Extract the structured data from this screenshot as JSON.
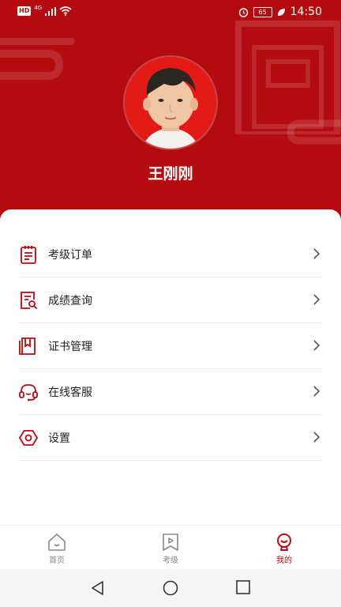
{
  "status_bar": {
    "left_badge": "HD",
    "network": "4G",
    "battery": "65",
    "time": "14:50"
  },
  "profile": {
    "name": "王刚刚"
  },
  "menu": {
    "items": [
      {
        "label": "考级订单",
        "icon": "clipboard-icon"
      },
      {
        "label": "成绩查询",
        "icon": "document-search-icon"
      },
      {
        "label": "证书管理",
        "icon": "certificate-book-icon"
      },
      {
        "label": "在线客服",
        "icon": "headset-icon"
      },
      {
        "label": "设置",
        "icon": "hexagon-settings-icon"
      }
    ]
  },
  "bottom_nav": {
    "items": [
      {
        "label": "首页",
        "icon": "home-icon",
        "active": false
      },
      {
        "label": "考级",
        "icon": "play-bookmark-icon",
        "active": false
      },
      {
        "label": "我的",
        "icon": "profile-icon",
        "active": true
      }
    ]
  },
  "colors": {
    "brand": "#b40b10",
    "avatar_bg": "#e41a17",
    "inactive": "#888888"
  }
}
